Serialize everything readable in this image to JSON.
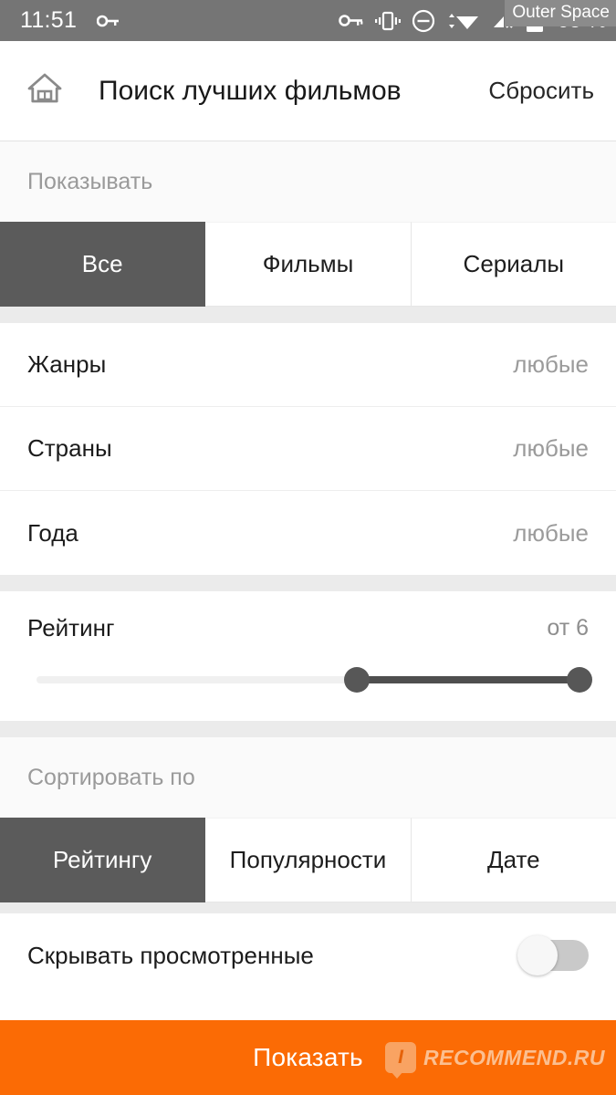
{
  "status_bar": {
    "time": "11:51",
    "battery_percent": "65 %",
    "tooltip": "Outer Space",
    "left_icons": [
      "key-icon"
    ],
    "right_icons": [
      "key-icon",
      "vibrate-icon",
      "do-not-disturb-icon",
      "wifi-icon",
      "mobile-signal-off-icon",
      "battery-icon"
    ],
    "background_color": "#757575"
  },
  "appbar": {
    "home_icon": "home-icon",
    "title": "Поиск лучших фильмов",
    "reset_label": "Сбросить"
  },
  "show_section": {
    "header": "Показывать",
    "tabs": [
      {
        "label": "Все",
        "active": true
      },
      {
        "label": "Фильмы",
        "active": false
      },
      {
        "label": "Сериалы",
        "active": false
      }
    ]
  },
  "filters": [
    {
      "label": "Жанры",
      "value": "любые"
    },
    {
      "label": "Страны",
      "value": "любые"
    },
    {
      "label": "Года",
      "value": "любые"
    }
  ],
  "rating": {
    "label": "Рейтинг",
    "value": "от 6",
    "min_percent": 59,
    "max_percent": 100
  },
  "sort_section": {
    "header": "Сортировать по",
    "tabs": [
      {
        "label": "Рейтингу",
        "active": true
      },
      {
        "label": "Популярности",
        "active": false
      },
      {
        "label": "Дате",
        "active": false
      }
    ]
  },
  "hide_watched": {
    "label": "Скрывать просмотренные",
    "enabled": false
  },
  "cta": {
    "label": "Показать",
    "color": "#fb6b05"
  },
  "watermark": {
    "badge": "I",
    "text": "RECOMMEND.RU"
  }
}
